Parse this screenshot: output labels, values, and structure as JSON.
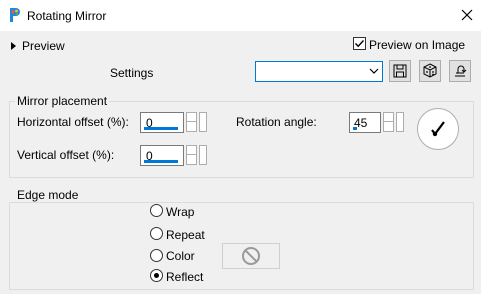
{
  "window": {
    "title": "Rotating Mirror",
    "close_glyph": "✕"
  },
  "preview": {
    "toggle_label": "Preview",
    "preview_on_image_label": "Preview on Image",
    "preview_on_image_checked": true
  },
  "settings": {
    "label": "Settings",
    "value": ""
  },
  "mirror_placement": {
    "group_label": "Mirror placement",
    "horizontal_label": "Horizontal offset (%):",
    "horizontal_value": "0",
    "vertical_label": "Vertical offset (%):",
    "vertical_value": "0",
    "rotation_label": "Rotation angle:",
    "rotation_value": "45"
  },
  "edge_mode": {
    "group_label": "Edge mode",
    "options": [
      {
        "label": "Wrap",
        "selected": false
      },
      {
        "label": "Repeat",
        "selected": false
      },
      {
        "label": "Color",
        "selected": false
      },
      {
        "label": "Reflect",
        "selected": true
      }
    ]
  },
  "colors": {
    "accent": "#0078d7",
    "panel": "#f0f0f0"
  },
  "icons": [
    "app-icon",
    "close-icon",
    "disclosure-triangle-icon",
    "save-icon",
    "randomize-dice-icon",
    "reset-icon",
    "angle-dial-icon",
    "no-color-icon"
  ]
}
